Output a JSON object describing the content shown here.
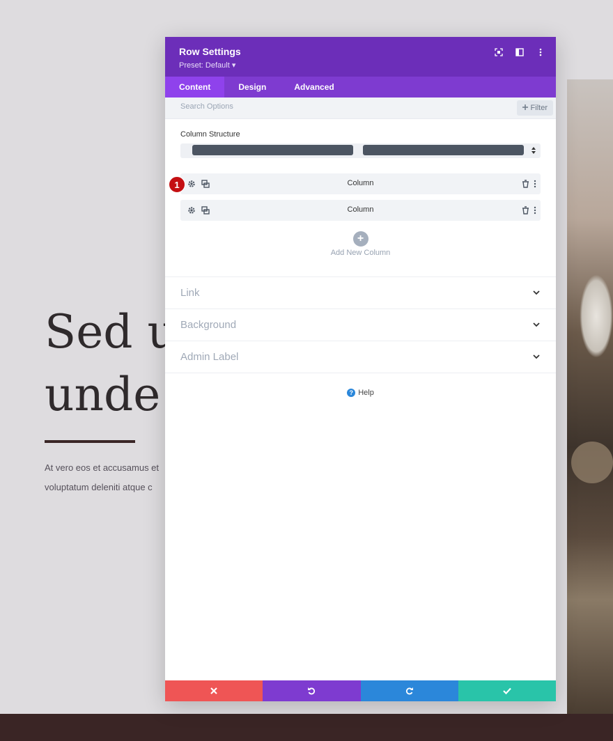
{
  "background": {
    "heading": "Sed ut\nunde o",
    "paragraph": "At vero eos et accusamus et\nvoluptatum deleniti atque c"
  },
  "modal": {
    "title": "Row Settings",
    "preset": "Preset: Default ▾",
    "header_icons": [
      "screenshot-icon",
      "split-view-icon",
      "more-vertical-icon"
    ],
    "tabs": [
      {
        "label": "Content",
        "active": true
      },
      {
        "label": "Design",
        "active": false
      },
      {
        "label": "Advanced",
        "active": false
      }
    ],
    "search": {
      "placeholder": "Search Options",
      "filter_label": "Filter"
    },
    "column_structure_label": "Column Structure",
    "columns": [
      {
        "label": "Column",
        "badge": "1"
      },
      {
        "label": "Column"
      }
    ],
    "add_column_label": "Add New Column",
    "toggles": [
      "Link",
      "Background",
      "Admin Label"
    ],
    "help_label": "Help",
    "footer": {
      "cancel_color": "#ef5555",
      "undo_color": "#7e3bd0",
      "redo_color": "#2b87da",
      "save_color": "#29c4a9"
    }
  },
  "colors": {
    "header": "#6c2eb9",
    "tabs": "#7e3bd0",
    "active_tab": "#8f42ec",
    "badge": "#c40f12"
  }
}
